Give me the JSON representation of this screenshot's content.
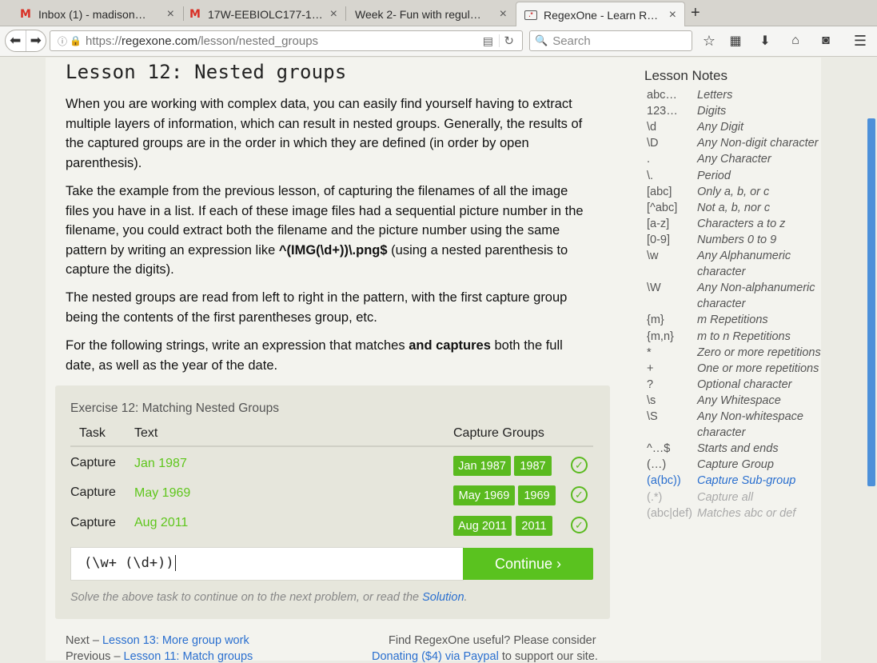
{
  "browser": {
    "tabs": [
      {
        "title": "Inbox (1) - madison…",
        "icon": "gmail-icon"
      },
      {
        "title": "17W-EEBIOLC177-1:…",
        "icon": "gmail-icon"
      },
      {
        "title": "Week 2- Fun with regul…",
        "icon": "document-icon"
      },
      {
        "title": "RegexOne - Learn R…",
        "icon": "regexone-icon"
      }
    ],
    "close_glyph": "×",
    "new_tab_glyph": "+",
    "url": {
      "scheme": "https://",
      "host": "regexone.com",
      "path": "/lesson/nested_groups"
    },
    "search_placeholder": "Search"
  },
  "lesson": {
    "title": "Lesson 12: Nested groups",
    "paragraphs": [
      "When you are working with complex data, you can easily find yourself having to extract multiple layers of information, which can result in nested groups. Generally, the results of the captured groups are in the order in which they are defined (in order by open parenthesis).",
      "The nested groups are read from left to right in the pattern, with the first capture group being the contents of the first parentheses group, etc."
    ],
    "para2_before": "Take the example from the previous lesson, of capturing the filenames of all the image files you have in a list. If each of these image files had a sequential picture number in the filename, you could extract both the filename and the picture number using the same pattern by writing an expression like ",
    "para2_code": "^(IMG(\\d+))\\.png$",
    "para2_after": " (using a nested parenthesis to capture the digits).",
    "para4_before": "For the following strings, write an expression that matches ",
    "para4_bold": "and captures",
    "para4_after": " both the full date, as well as the year of the date."
  },
  "exercise": {
    "title": "Exercise 12: Matching Nested Groups",
    "headers": {
      "task": "Task",
      "text": "Text",
      "groups": "Capture Groups"
    },
    "rows": [
      {
        "task": "Capture",
        "text": "Jan 1987",
        "groups": [
          "Jan 1987",
          "1987"
        ]
      },
      {
        "task": "Capture",
        "text": "May 1969",
        "groups": [
          "May 1969",
          "1969"
        ]
      },
      {
        "task": "Capture",
        "text": "Aug 2011",
        "groups": [
          "Aug 2011",
          "2011"
        ]
      }
    ],
    "input_value": "(\\w+ (\\d+))",
    "continue_label": "Continue ›",
    "hint_before": "Solve the above task to continue on to the next problem, or read the ",
    "hint_link": "Solution",
    "hint_after": "."
  },
  "footer": {
    "next_label": "Next – ",
    "next_link": "Lesson 13: More group work",
    "prev_label": "Previous – ",
    "prev_link": "Lesson 11: Match groups",
    "useful": "Find RegexOne useful? Please consider",
    "donate_link": "Donating ($4) via Paypal",
    "donate_after": " to support our site."
  },
  "notes": {
    "title": "Lesson Notes",
    "items": [
      {
        "key": "abc…",
        "desc": "Letters"
      },
      {
        "key": "123…",
        "desc": "Digits"
      },
      {
        "key": "\\d",
        "desc": "Any Digit"
      },
      {
        "key": "\\D",
        "desc": "Any Non-digit character"
      },
      {
        "key": ".",
        "desc": "Any Character"
      },
      {
        "key": "\\.",
        "desc": "Period"
      },
      {
        "key": "[abc]",
        "desc": "Only a, b, or c"
      },
      {
        "key": "[^abc]",
        "desc": "Not a, b, nor c"
      },
      {
        "key": "[a-z]",
        "desc": "Characters a to z"
      },
      {
        "key": "[0-9]",
        "desc": "Numbers 0 to 9"
      },
      {
        "key": "\\w",
        "desc": "Any Alphanumeric character"
      },
      {
        "key": "\\W",
        "desc": "Any Non-alphanumeric character"
      },
      {
        "key": "{m}",
        "desc": "m Repetitions"
      },
      {
        "key": "{m,n}",
        "desc": "m to n Repetitions"
      },
      {
        "key": "*",
        "desc": "Zero or more repetitions"
      },
      {
        "key": "+",
        "desc": "One or more repetitions"
      },
      {
        "key": "?",
        "desc": "Optional character"
      },
      {
        "key": "\\s",
        "desc": "Any Whitespace"
      },
      {
        "key": "\\S",
        "desc": "Any Non-whitespace character"
      },
      {
        "key": "^…$",
        "desc": "Starts and ends"
      },
      {
        "key": "(…)",
        "desc": "Capture Group"
      },
      {
        "key": "(a(bc))",
        "desc": "Capture Sub-group"
      },
      {
        "key": "(.*)",
        "desc": "Capture all"
      },
      {
        "key": "(abc|def)",
        "desc": "Matches abc or def"
      }
    ]
  },
  "colors": {
    "accent_green": "#5aba1f",
    "link_blue": "#2a6fcf",
    "scroll_blue": "#4c90d9"
  }
}
